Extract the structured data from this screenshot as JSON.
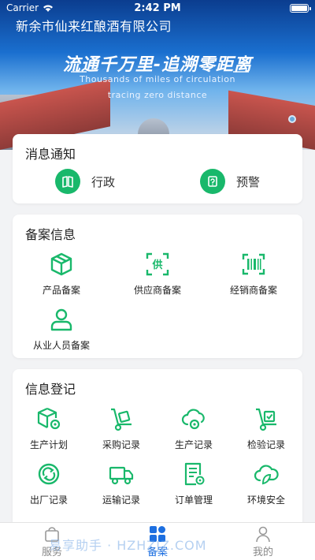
{
  "status_bar": {
    "carrier": "Carrier",
    "time": "2:42 PM"
  },
  "banner": {
    "company": "新余市仙来红酿酒有限公司",
    "slogan_cn": "流通千万里-追溯零距离",
    "slogan_en_line1": "Thousands of miles of circulation",
    "slogan_en_line2": "tracing zero distance"
  },
  "notice": {
    "title": "消息通知",
    "items": [
      {
        "label": "行政",
        "icon": "book-icon"
      },
      {
        "label": "预警",
        "icon": "warning-doc-icon"
      }
    ]
  },
  "filing": {
    "title": "备案信息",
    "items": [
      {
        "label": "产品备案",
        "icon": "box-icon"
      },
      {
        "label": "供应商备案",
        "icon": "supplier-icon",
        "icon_text": "供"
      },
      {
        "label": "经销商备案",
        "icon": "barcode-icon"
      },
      {
        "label": "从业人员备案",
        "icon": "person-icon"
      }
    ]
  },
  "register": {
    "title": "信息登记",
    "items": [
      {
        "label": "生产计划",
        "icon": "box-gear-icon"
      },
      {
        "label": "采购记录",
        "icon": "hand-truck-icon"
      },
      {
        "label": "生产记录",
        "icon": "cloud-gear-icon"
      },
      {
        "label": "检验记录",
        "icon": "hand-truck-check-icon"
      },
      {
        "label": "出厂记录",
        "icon": "recycle-icon"
      },
      {
        "label": "运输记录",
        "icon": "truck-icon"
      },
      {
        "label": "订单管理",
        "icon": "document-gear-icon"
      },
      {
        "label": "环境安全",
        "icon": "leaf-cloud-icon"
      }
    ]
  },
  "tabbar": {
    "tabs": [
      {
        "label": "服务",
        "icon": "bag-icon",
        "active": false
      },
      {
        "label": "备案",
        "icon": "grid-icon",
        "active": true
      },
      {
        "label": "我的",
        "icon": "user-icon",
        "active": false
      }
    ]
  },
  "watermark": "易享助手 · HZHZJZ.COM",
  "colors": {
    "accent_green": "#19b86b",
    "tab_active_blue": "#1d6fe0"
  }
}
